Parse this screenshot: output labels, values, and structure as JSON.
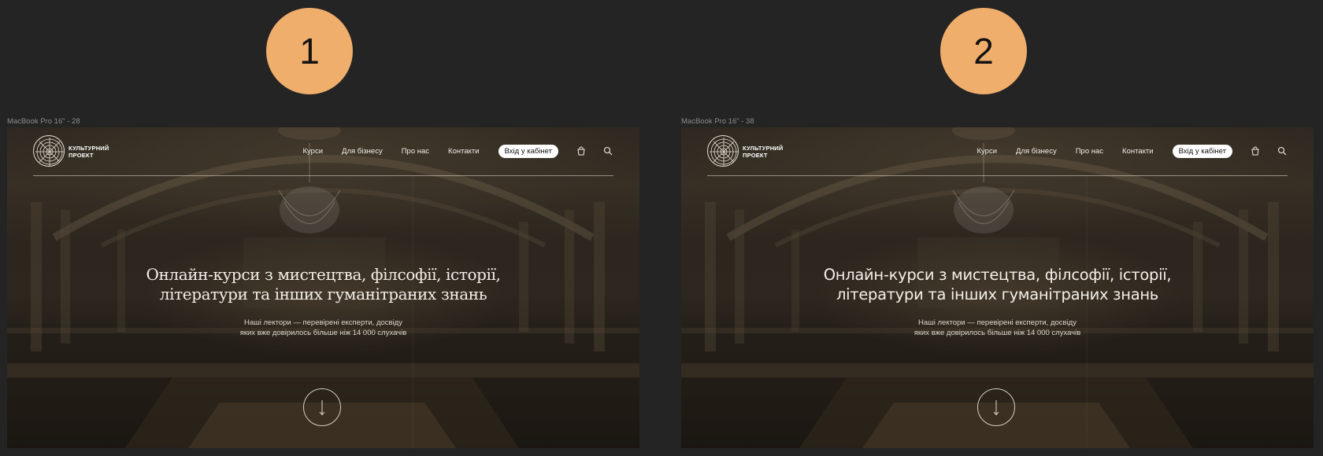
{
  "frames": [
    {
      "badge": "1",
      "frame_label": "MacBook Pro 16\" - 28",
      "logo": {
        "line1": "КУЛЬТУРНИЙ",
        "line2": "ПРОЕКТ"
      },
      "nav": {
        "items": [
          "Курси",
          "Для бізнесу",
          "Про нас",
          "Контакти"
        ],
        "cabinet_button": "Вхід у кабінет",
        "icons": [
          "cart-icon",
          "search-icon"
        ]
      },
      "hero": {
        "title_line1": "Онлайн-курси з мистецтва, філсофії, історії,",
        "title_line2": "літератури та інших гуманітраних знань",
        "subtitle_line1": "Наші лектори — перевірені експерти, досвіду",
        "subtitle_line2": "яких вже довірилось більше ніж 14 000 слухачів"
      }
    },
    {
      "badge": "2",
      "frame_label": "MacBook Pro 16\" - 38",
      "logo": {
        "line1": "КУЛЬТУРНИЙ",
        "line2": "ПРОЕКТ"
      },
      "nav": {
        "items": [
          "Курси",
          "Для бізнесу",
          "Про нас",
          "Контакти"
        ],
        "cabinet_button": "Вхід у кабінет",
        "icons": [
          "cart-icon",
          "search-icon"
        ]
      },
      "hero": {
        "title_line1": "Онлайн-курси з мистецтва, філсофії, історії,",
        "title_line2": "літератури та інших гуманітраних знань",
        "subtitle_line1": "Наші лектори — перевірені експерти, досвіду",
        "subtitle_line2": "яких вже довірилось більше ніж 14 000 слухачів"
      }
    }
  ],
  "colors": {
    "canvas_background": "#242424",
    "badge": "#f0ae6c",
    "button_background": "#ffffff"
  }
}
